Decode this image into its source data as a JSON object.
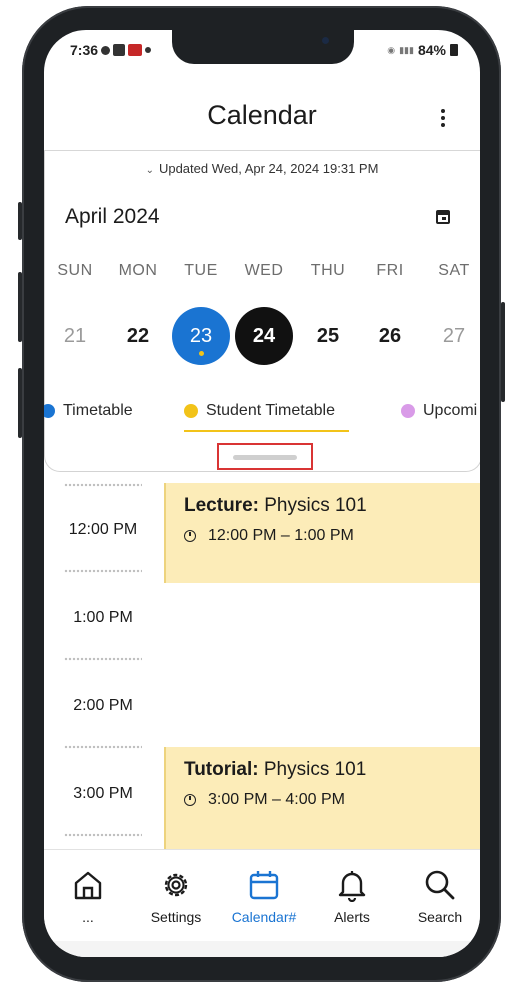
{
  "status_bar": {
    "time": "7:36",
    "battery": "84%"
  },
  "header": {
    "title": "Calendar"
  },
  "calendar": {
    "updated_text": "Updated Wed, Apr 24, 2024 19:31 PM",
    "month_label": "April 2024",
    "weekdays": [
      "SUN",
      "MON",
      "TUE",
      "WED",
      "THU",
      "FRI",
      "SAT"
    ],
    "days": [
      "21",
      "22",
      "23",
      "24",
      "25",
      "26",
      "27"
    ],
    "today": "23",
    "selected": "24"
  },
  "tabs": [
    {
      "label": "Timetable",
      "color": "#1a74d2"
    },
    {
      "label": "Student Timetable",
      "color": "#f2c319",
      "active": true
    },
    {
      "label": "Upcomi",
      "color": "#d99be8"
    }
  ],
  "timeline": {
    "times": [
      "12:00 PM",
      "1:00 PM",
      "2:00 PM",
      "3:00 PM"
    ],
    "events": [
      {
        "type": "Lecture:",
        "title": "Physics 101",
        "time": "12:00 PM – 1:00 PM"
      },
      {
        "type": "Tutorial:",
        "title": "Physics 101",
        "time": "3:00 PM – 4:00 PM"
      }
    ]
  },
  "nav": [
    {
      "label": "...",
      "icon": "home-icon"
    },
    {
      "label": "Settings",
      "icon": "gear-icon"
    },
    {
      "label": "Calendar#",
      "icon": "calendar-icon",
      "active": true
    },
    {
      "label": "Alerts",
      "icon": "bell-icon"
    },
    {
      "label": "Search",
      "icon": "search-icon"
    }
  ],
  "colors": {
    "accent": "#1a74d2",
    "event_bg": "#fcecb8",
    "highlight": "#f2c319",
    "annotation": "#d93434"
  }
}
